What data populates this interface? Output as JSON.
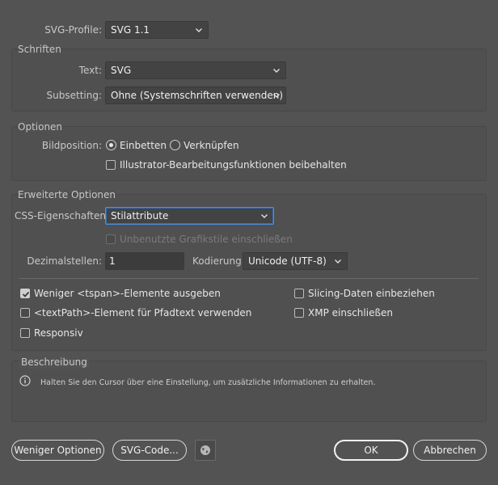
{
  "svg_profile": {
    "label": "SVG-Profile:",
    "value": "SVG 1.1"
  },
  "schriften": {
    "title": "Schriften",
    "text_label": "Text:",
    "text_value": "SVG",
    "subsetting_label": "Subsetting:",
    "subsetting_value": "Ohne (Systemschriften verwenden)"
  },
  "optionen": {
    "title": "Optionen",
    "bildposition_label": "Bildposition:",
    "radio_einbetten": "Einbetten",
    "radio_verknuepfen": "Verknüpfen",
    "selected_radio": "Einbetten",
    "illustrator_label": "Illustrator-Bearbeitungsfunktionen beibehalten",
    "illustrator_checked": false
  },
  "erweitert": {
    "title": "Erweiterte Optionen",
    "css_label": "CSS-Eigenschaften:",
    "css_value": "Stilattribute",
    "unused_styles_label": "Unbenutzte Grafikstile einschließen",
    "unused_styles_enabled": false,
    "dezimal_label": "Dezimalstellen:",
    "dezimal_value": "1",
    "kodierung_label": "Kodierung:",
    "kodierung_value": "Unicode (UTF-8)",
    "checkboxes": {
      "tspan": {
        "label": "Weniger <tspan>-Elemente ausgeben",
        "checked": true
      },
      "slicing": {
        "label": "Slicing-Daten einbeziehen",
        "checked": false
      },
      "textpath": {
        "label": "<textPath>-Element für Pfadtext verwenden",
        "checked": false
      },
      "xmp": {
        "label": "XMP einschließen",
        "checked": false
      },
      "responsiv": {
        "label": "Responsiv",
        "checked": false
      }
    }
  },
  "beschreibung": {
    "title": "Beschreibung",
    "hint": "Halten Sie den Cursor über eine Einstellung, um zusätzliche Informationen zu erhalten."
  },
  "buttons": {
    "weniger_optionen": "Weniger Optionen",
    "svg_code": "SVG-Code...",
    "ok": "OK",
    "abbrechen": "Abbrechen"
  },
  "icons": {
    "info": "info-icon",
    "globe": "globe-icon",
    "chevron": "chevron-down-icon",
    "checkmark": "checkmark-icon"
  }
}
